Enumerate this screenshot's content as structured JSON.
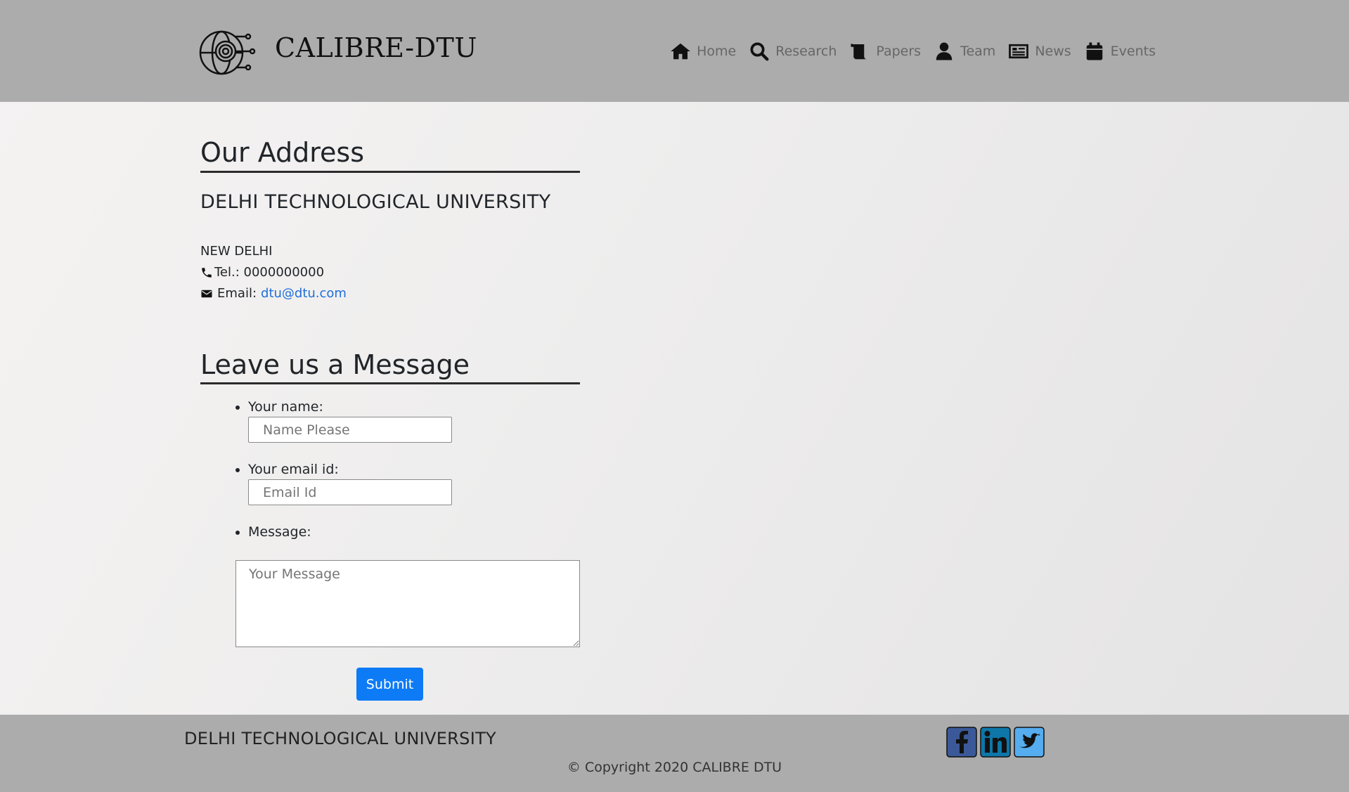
{
  "header": {
    "brand": "CALIBRE-DTU",
    "nav": [
      {
        "label": "Home",
        "icon": "home-icon"
      },
      {
        "label": "Research",
        "icon": "search-icon"
      },
      {
        "label": "Papers",
        "icon": "scroll-icon"
      },
      {
        "label": "Team",
        "icon": "user-icon"
      },
      {
        "label": "News",
        "icon": "newspaper-icon"
      },
      {
        "label": "Events",
        "icon": "calendar-icon"
      }
    ]
  },
  "address": {
    "title": "Our Address",
    "university": "DELHI TECHNOLOGICAL UNIVERSITY",
    "city": "NEW DELHI",
    "tel": "Tel.: 0000000000",
    "email_label": "Email:",
    "email": "dtu@dtu.com"
  },
  "form": {
    "title": "Leave us a Message",
    "name_label": "Your name:",
    "name_placeholder": "Name Please",
    "email_label": "Your email id:",
    "email_placeholder": "Email Id",
    "message_label": "Message:",
    "message_placeholder": "Your Message",
    "submit": "Submit"
  },
  "footer": {
    "university": "DELHI TECHNOLOGICAL UNIVERSITY",
    "copyright": "© Copyright 2020 CALIBRE DTU",
    "social": [
      {
        "name": "facebook-icon",
        "color": "#3b5998"
      },
      {
        "name": "linkedin-icon",
        "color": "#0e76a8"
      },
      {
        "name": "twitter-icon",
        "color": "#55acee"
      }
    ]
  }
}
